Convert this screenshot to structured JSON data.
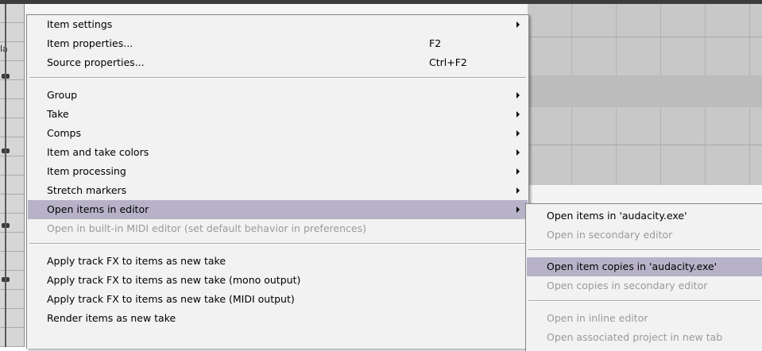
{
  "context_menu": {
    "group1": [
      {
        "label": "Item settings",
        "shortcut": "",
        "submenu": true
      },
      {
        "label": "Item properties...",
        "shortcut": "F2",
        "submenu": false
      },
      {
        "label": "Source properties...",
        "shortcut": "Ctrl+F2",
        "submenu": false
      }
    ],
    "group2": [
      {
        "label": "Group",
        "submenu": true
      },
      {
        "label": "Take",
        "submenu": true
      },
      {
        "label": "Comps",
        "submenu": true
      },
      {
        "label": "Item and take colors",
        "submenu": true
      },
      {
        "label": "Item processing",
        "submenu": true
      },
      {
        "label": "Stretch markers",
        "submenu": true
      },
      {
        "label": "Open items in editor",
        "submenu": true,
        "highlighted": true
      },
      {
        "label": "Open in built-in MIDI editor (set default behavior in preferences)",
        "disabled": true
      }
    ],
    "group3": [
      {
        "label": "Apply track FX to items as new take"
      },
      {
        "label": "Apply track FX to items as new take (mono output)"
      },
      {
        "label": "Apply track FX to items as new take (MIDI output)"
      },
      {
        "label": "Render items as new take"
      }
    ]
  },
  "editor_submenu": {
    "items": [
      {
        "label": "Open items in 'audacity.exe'",
        "disabled": false
      },
      {
        "label": "Open in secondary editor",
        "disabled": true
      },
      {
        "label": "Open item copies in 'audacity.exe'",
        "disabled": false,
        "highlighted": true
      },
      {
        "label": "Open copies in secondary editor",
        "disabled": true
      },
      {
        "label": "Open in inline editor",
        "disabled": true
      },
      {
        "label": "Open associated project in new tab",
        "disabled": true
      }
    ]
  },
  "track_strip": {
    "label": "la"
  },
  "colors": {
    "highlight": "#b7b2c8",
    "menu_bg": "#f2f2f2",
    "disabled_text": "#9a9a9a"
  }
}
